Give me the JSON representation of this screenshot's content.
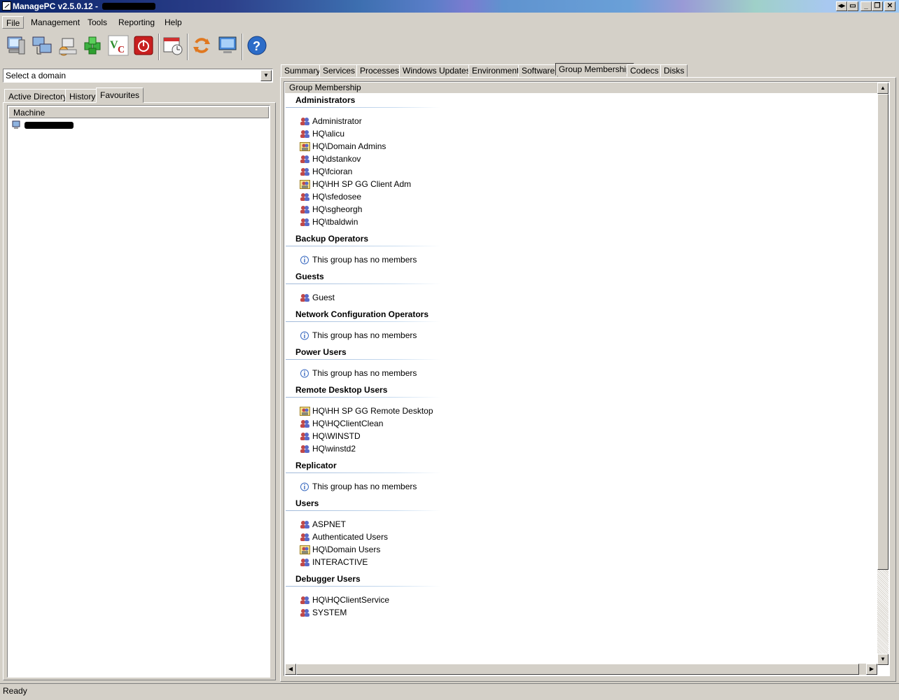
{
  "window": {
    "title": "ManagePC v2.5.0.12 -",
    "buttons": [
      "◂▸",
      "▭",
      "_",
      "❐",
      "✕"
    ]
  },
  "menu": [
    {
      "label": "File",
      "active": true
    },
    {
      "label": "Management",
      "active": false
    },
    {
      "label": "Tools",
      "active": false
    },
    {
      "label": "Reporting",
      "active": false
    },
    {
      "label": "Help",
      "active": false
    }
  ],
  "toolbar": [
    "computer-icon",
    "network-computers-icon",
    "remote-install-icon",
    "green-blocks-icon",
    "vnc-icon",
    "shutdown-icon",
    "scheduler-icon",
    "refresh-icon",
    "remote-desktop-icon",
    "help-icon"
  ],
  "domain_select": {
    "placeholder": "Select a domain"
  },
  "left_tabs": [
    {
      "label": "Active Directory",
      "active": false
    },
    {
      "label": "History",
      "active": false
    },
    {
      "label": "Favourites",
      "active": true
    }
  ],
  "machine_list": {
    "column": "Machine"
  },
  "right_tabs": [
    {
      "label": "Summary",
      "active": false
    },
    {
      "label": "Services",
      "active": false
    },
    {
      "label": "Processes",
      "active": false
    },
    {
      "label": "Windows Updates",
      "active": false
    },
    {
      "label": "Environment",
      "active": false
    },
    {
      "label": "Software",
      "active": false
    },
    {
      "label": "Group Membership",
      "active": true
    },
    {
      "label": "Codecs",
      "active": false
    },
    {
      "label": "Disks",
      "active": false
    }
  ],
  "group_membership": {
    "header": "Group Membership",
    "groups": [
      {
        "name": "Administrators",
        "members": [
          {
            "name": "Administrator",
            "type": "user"
          },
          {
            "name": "HQ\\alicu",
            "type": "user"
          },
          {
            "name": "HQ\\Domain Admins",
            "type": "group"
          },
          {
            "name": "HQ\\dstankov",
            "type": "user"
          },
          {
            "name": "HQ\\fcioran",
            "type": "user"
          },
          {
            "name": "HQ\\HH SP GG Client Adm",
            "type": "group"
          },
          {
            "name": "HQ\\sfedosee",
            "type": "user"
          },
          {
            "name": "HQ\\sgheorgh",
            "type": "user"
          },
          {
            "name": "HQ\\tbaldwin",
            "type": "user"
          }
        ]
      },
      {
        "name": "Backup Operators",
        "members": [
          {
            "name": "This group has no members",
            "type": "info"
          }
        ]
      },
      {
        "name": "Guests",
        "members": [
          {
            "name": "Guest",
            "type": "user"
          }
        ]
      },
      {
        "name": "Network Configuration Operators",
        "members": [
          {
            "name": "This group has no members",
            "type": "info"
          }
        ]
      },
      {
        "name": "Power Users",
        "members": [
          {
            "name": "This group has no members",
            "type": "info"
          }
        ]
      },
      {
        "name": "Remote Desktop Users",
        "members": [
          {
            "name": "HQ\\HH SP GG Remote Desktop",
            "type": "group"
          },
          {
            "name": "HQ\\HQClientClean",
            "type": "user"
          },
          {
            "name": "HQ\\WINSTD",
            "type": "user"
          },
          {
            "name": "HQ\\winstd2",
            "type": "user"
          }
        ]
      },
      {
        "name": "Replicator",
        "members": [
          {
            "name": "This group has no members",
            "type": "info"
          }
        ]
      },
      {
        "name": "Users",
        "members": [
          {
            "name": "ASPNET",
            "type": "user"
          },
          {
            "name": "Authenticated Users",
            "type": "user"
          },
          {
            "name": "HQ\\Domain Users",
            "type": "group"
          },
          {
            "name": "INTERACTIVE",
            "type": "user"
          }
        ]
      },
      {
        "name": "Debugger Users",
        "members": [
          {
            "name": "HQ\\HQClientService",
            "type": "user"
          },
          {
            "name": "SYSTEM",
            "type": "user"
          }
        ]
      }
    ]
  },
  "status": {
    "text": "Ready"
  }
}
